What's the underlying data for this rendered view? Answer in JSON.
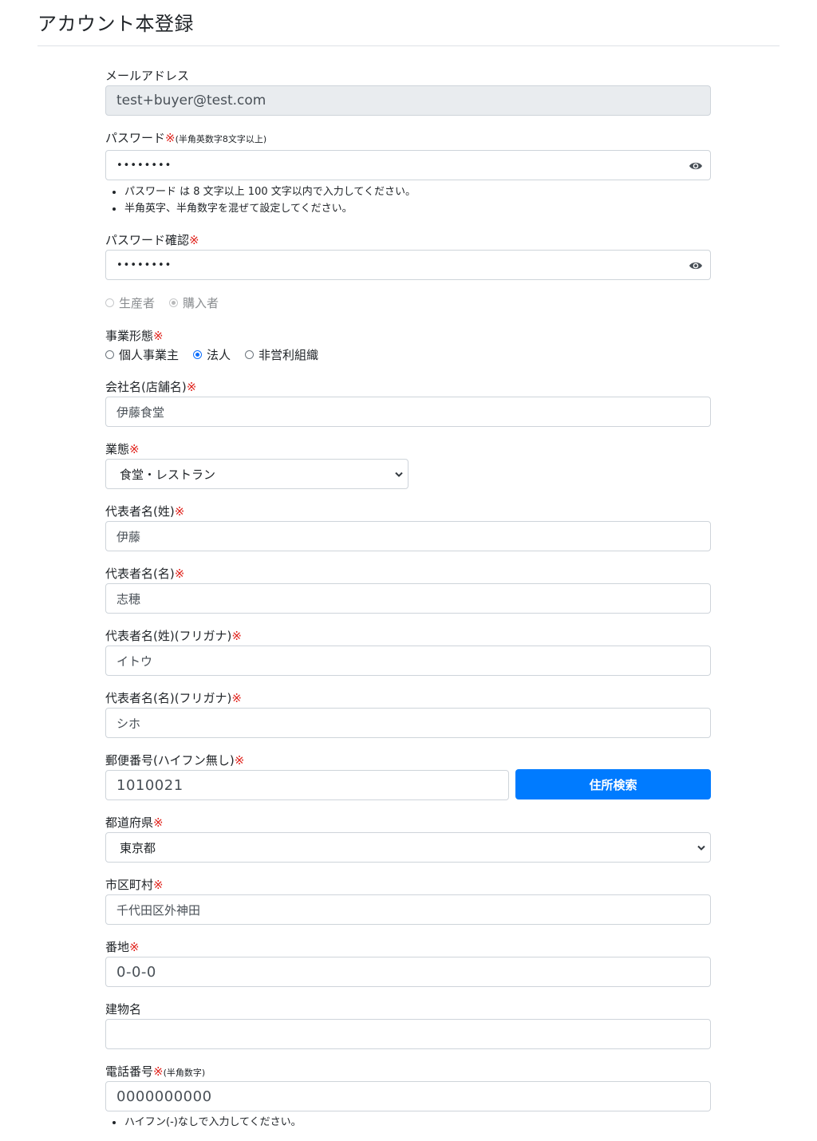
{
  "page": {
    "title": "アカウント本登録"
  },
  "required_mark": "※",
  "email": {
    "label": "メールアドレス",
    "value": "test+buyer@test.com"
  },
  "password": {
    "label": "パスワード",
    "note": "(半角英数字8文字以上)",
    "value": "••••••••",
    "help": [
      "パスワード は 8 文字以上 100 文字以内で入力してください。",
      "半角英字、半角数字を混ぜて設定してください。"
    ]
  },
  "password_confirm": {
    "label": "パスワード確認",
    "value": "••••••••"
  },
  "user_type": {
    "options": [
      {
        "label": "生産者",
        "checked": false
      },
      {
        "label": "購入者",
        "checked": true
      }
    ]
  },
  "business_form": {
    "label": "事業形態",
    "options": [
      {
        "label": "個人事業主",
        "checked": false
      },
      {
        "label": "法人",
        "checked": true
      },
      {
        "label": "非営利組織",
        "checked": false
      }
    ]
  },
  "company_name": {
    "label": "会社名(店舗名)",
    "value": "伊藤食堂"
  },
  "business_type": {
    "label": "業態",
    "value": "食堂・レストラン"
  },
  "rep_last_name": {
    "label": "代表者名(姓)",
    "value": "伊藤"
  },
  "rep_first_name": {
    "label": "代表者名(名)",
    "value": "志穂"
  },
  "rep_last_kana": {
    "label": "代表者名(姓)(フリガナ)",
    "value": "イトウ"
  },
  "rep_first_kana": {
    "label": "代表者名(名)(フリガナ)",
    "value": "シホ"
  },
  "postal_code": {
    "label": "郵便番号(ハイフン無し)",
    "value": "1010021",
    "button": "住所検索"
  },
  "prefecture": {
    "label": "都道府県",
    "value": "東京都"
  },
  "city": {
    "label": "市区町村",
    "value": "千代田区外神田"
  },
  "street": {
    "label": "番地",
    "value": "0-0-0"
  },
  "building": {
    "label": "建物名",
    "value": ""
  },
  "phone": {
    "label": "電話番号",
    "note": "(半角数字)",
    "value": "0000000000",
    "help": [
      "ハイフン(-)なしで入力してください。"
    ]
  },
  "colors": {
    "primary": "#007bff",
    "required": "#e0221b",
    "readonly_bg": "#e9ecef"
  }
}
